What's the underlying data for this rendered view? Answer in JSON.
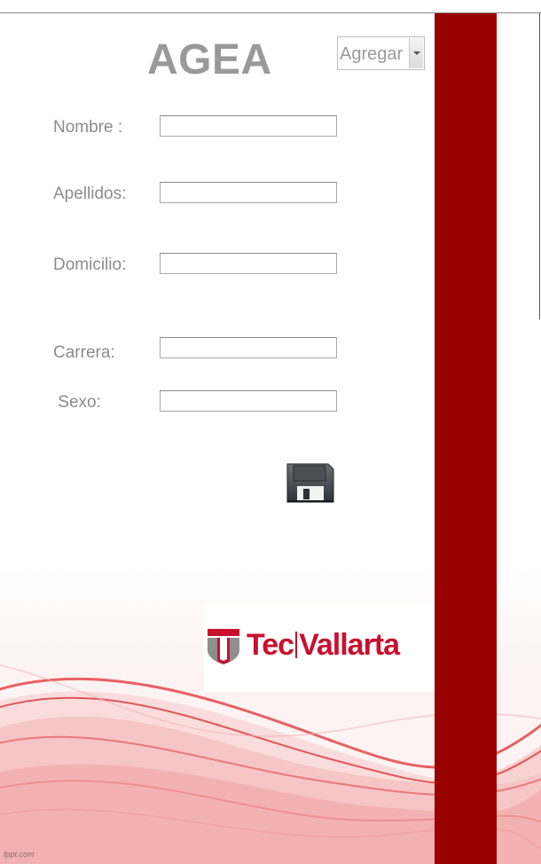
{
  "app": {
    "title": "AGEA"
  },
  "mode_select": {
    "selected": "Agregar"
  },
  "form": {
    "fields": [
      {
        "label": "Nombre :",
        "value": ""
      },
      {
        "label": "Apellidos:",
        "value": ""
      },
      {
        "label": "Domicilio:",
        "value": ""
      },
      {
        "label": "Carrera:",
        "value": ""
      },
      {
        "label": " Sexo:",
        "value": ""
      }
    ]
  },
  "save_button": {
    "icon": "floppy-disk-icon"
  },
  "logo": {
    "brand_left": "Tec",
    "brand_right": "Vallarta"
  },
  "watermark": "fppt.com",
  "colors": {
    "side_bar": "#990000",
    "brand_red": "#c8102e",
    "label_gray": "#8c8c8c",
    "title_gray": "#999999"
  }
}
